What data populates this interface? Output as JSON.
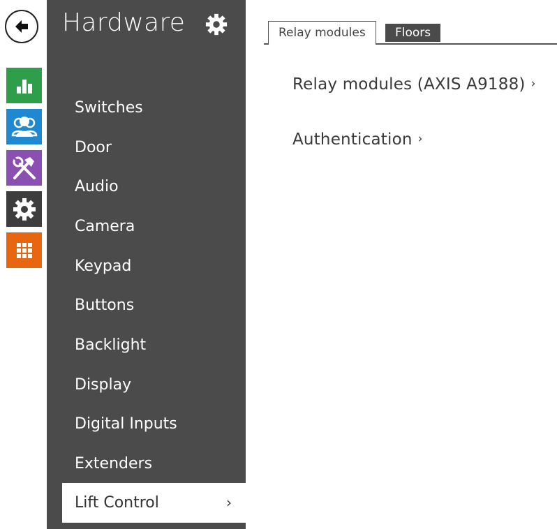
{
  "colors": {
    "sidebar_bg": "#4b4b4b",
    "status_tile": "#2e9e4a",
    "directory_tile": "#1e88d0",
    "services_tile": "#8a4fb0",
    "system_tile": "#3d3d3d",
    "grid_tile": "#e8660f"
  },
  "rail": {
    "back_icon": "arrow-left-icon",
    "tiles": [
      {
        "icon": "bar-chart-icon"
      },
      {
        "icon": "users-icon"
      },
      {
        "icon": "tools-icon"
      },
      {
        "icon": "gear-icon"
      },
      {
        "icon": "grid-icon"
      }
    ]
  },
  "sidebar": {
    "title": "Hardware",
    "title_icon": "gear-icon",
    "items": [
      {
        "label": "Switches"
      },
      {
        "label": "Door"
      },
      {
        "label": "Audio"
      },
      {
        "label": "Camera"
      },
      {
        "label": "Keypad"
      },
      {
        "label": "Buttons"
      },
      {
        "label": "Backlight"
      },
      {
        "label": "Display"
      },
      {
        "label": "Digital Inputs"
      },
      {
        "label": "Extenders"
      },
      {
        "label": "Lift Control",
        "active": true,
        "chevron": "›"
      }
    ]
  },
  "tabs": [
    {
      "label": "Relay modules",
      "active": true
    },
    {
      "label": "Floors",
      "active": false
    }
  ],
  "main": {
    "links": [
      {
        "label": "Relay modules (AXIS A9188)",
        "chevron": "›"
      },
      {
        "label": "Authentication",
        "chevron": "›"
      }
    ]
  }
}
